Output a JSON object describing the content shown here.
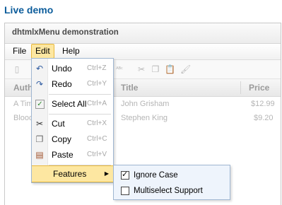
{
  "heading": "Live demo",
  "window": {
    "title": "dhtmlxMenu demonstration"
  },
  "menubar": {
    "items": [
      {
        "label": "File"
      },
      {
        "label": "Edit"
      },
      {
        "label": "Help"
      }
    ]
  },
  "grid": {
    "headers": [
      "Auth",
      "Title",
      "Price"
    ],
    "rows": [
      {
        "author": "A Tim",
        "title": "John Grisham",
        "price": "$12.99"
      },
      {
        "author": "Blood",
        "title": "Stephen King",
        "price": "$9.20"
      }
    ]
  },
  "edit_menu": {
    "items": [
      {
        "label": "Undo",
        "shortcut": "Ctrl+Z",
        "icon": "undo-icon"
      },
      {
        "label": "Redo",
        "shortcut": "Ctrl+Y",
        "icon": "redo-icon"
      },
      {
        "label": "Select All",
        "shortcut": "Ctrl+A",
        "icon": "select-all-icon"
      },
      {
        "label": "Cut",
        "shortcut": "Ctrl+X",
        "icon": "scissors-icon"
      },
      {
        "label": "Copy",
        "shortcut": "Ctrl+C",
        "icon": "copy-icon"
      },
      {
        "label": "Paste",
        "shortcut": "Ctrl+V",
        "icon": "paste-icon"
      },
      {
        "label": "Features",
        "shortcut": "",
        "icon": "chevron-right-icon"
      }
    ]
  },
  "features_submenu": {
    "items": [
      {
        "label": "Ignore Case",
        "checked": true
      },
      {
        "label": "Multiselect Support",
        "checked": false
      }
    ]
  },
  "colors": {
    "accent": "#0b5c9b",
    "highlight": "#fde7a1",
    "highlight_border": "#e9b93d"
  }
}
